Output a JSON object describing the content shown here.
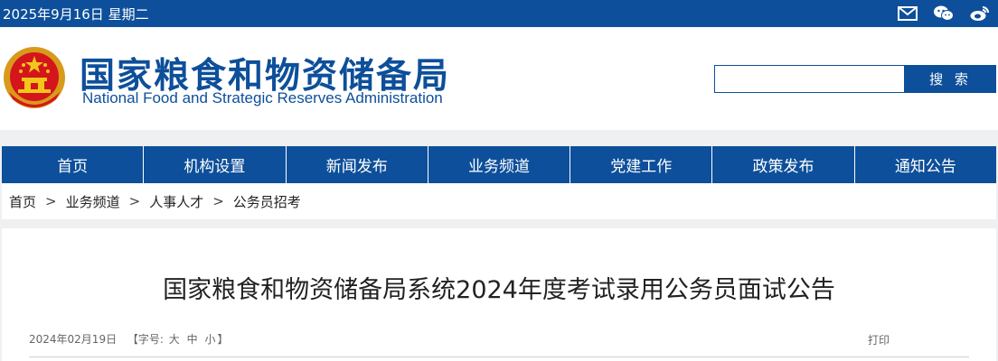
{
  "topbar": {
    "date": "2025年9月16日 星期二",
    "icons": [
      "mail-icon",
      "wechat-icon",
      "weibo-icon"
    ]
  },
  "header": {
    "title_cn": "国家粮食和物资储备局",
    "title_en": "National Food and Strategic Reserves Administration",
    "emblem": "national-emblem"
  },
  "search": {
    "placeholder": "",
    "button_label": "搜 索"
  },
  "nav": {
    "items": [
      "首页",
      "机构设置",
      "新闻发布",
      "业务频道",
      "党建工作",
      "政策发布",
      "通知公告"
    ]
  },
  "breadcrumb": {
    "items": [
      "首页",
      "业务频道",
      "人事人才",
      "公务员招考"
    ],
    "separator": ">"
  },
  "article": {
    "title": "国家粮食和物资储备局系统2024年度考试录用公务员面试公告",
    "date": "2024年02月19日",
    "font_size_prefix": "【字号:",
    "font_sizes": [
      "大",
      "中",
      "小"
    ],
    "font_size_suffix": "】",
    "print_label": "打印"
  },
  "colors": {
    "brand_blue": "#0d4f9a",
    "background": "#eef0f2"
  }
}
